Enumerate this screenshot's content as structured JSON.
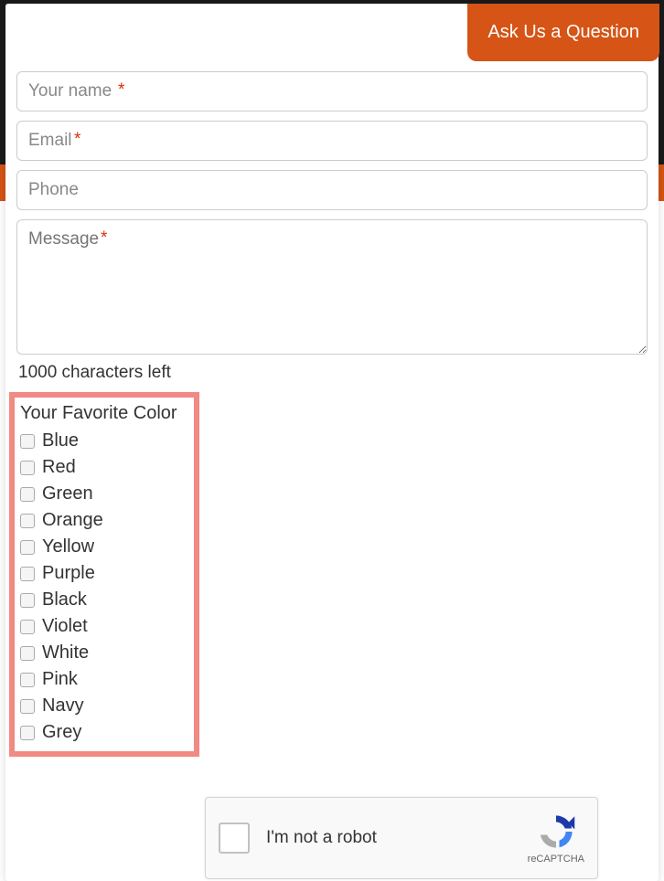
{
  "header": {
    "ask_button": "Ask Us a Question"
  },
  "form": {
    "name_placeholder": "Your name",
    "email_placeholder": "Email",
    "phone_placeholder": "Phone",
    "message_placeholder": "Message",
    "required_mark": "*",
    "char_counter": "1000 characters left"
  },
  "colors": {
    "title": "Your Favorite Color",
    "options": [
      "Blue",
      "Red",
      "Green",
      "Orange",
      "Yellow",
      "Purple",
      "Black",
      "Violet",
      "White",
      "Pink",
      "Navy",
      "Grey"
    ]
  },
  "recaptcha": {
    "label": "I'm not a robot",
    "brand": "reCAPTCHA"
  }
}
